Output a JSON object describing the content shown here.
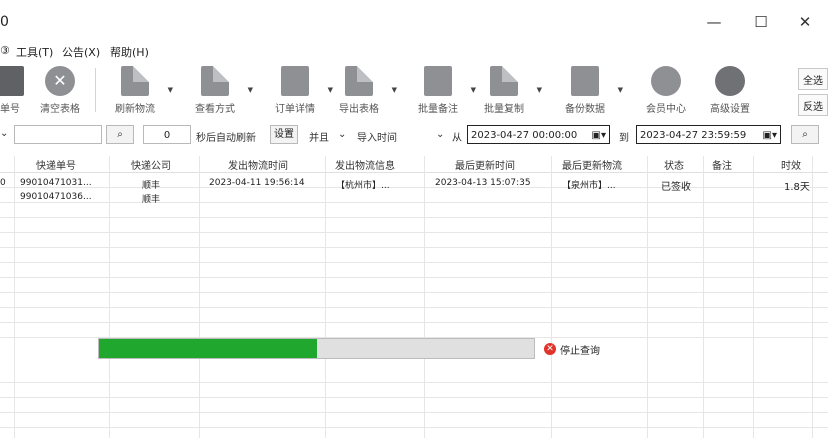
{
  "window": {
    "title": "0",
    "minimize": "—",
    "maximize": "☐",
    "close": "✕"
  },
  "menu": {
    "items": [
      "③",
      "工具(T)",
      "公告(X)",
      "帮助(H)"
    ]
  },
  "toolbar": {
    "items": [
      {
        "label": "单号",
        "icon": "scan-icon"
      },
      {
        "label": "清空表格",
        "icon": "clear-icon"
      },
      {
        "label": "刷新物流",
        "icon": "refresh-icon"
      },
      {
        "label": "查看方式",
        "icon": "view-icon"
      },
      {
        "label": "订单详情",
        "icon": "order-icon"
      },
      {
        "label": "导出表格",
        "icon": "export-icon"
      },
      {
        "label": "批量备注",
        "icon": "note-icon"
      },
      {
        "label": "批量复制",
        "icon": "copy-icon"
      },
      {
        "label": "备份数据",
        "icon": "backup-icon"
      },
      {
        "label": "会员中心",
        "icon": "member-icon"
      },
      {
        "label": "高级设置",
        "icon": "settings-icon"
      }
    ],
    "select_all": "全选",
    "invert": "反选"
  },
  "search": {
    "keyword_value": "",
    "interval_value": "0",
    "auto_refresh_label": "秒后自动刷新",
    "set_label": "设置",
    "range_select": "并且",
    "time_type": "导入时间",
    "from_label": "从",
    "from_datetime": "2023-04-27 00:00:00",
    "to_label": "到",
    "to_datetime": "2023-04-27 23:59:59"
  },
  "table": {
    "columns": [
      "快递单号",
      "快递公司",
      "发出物流时间",
      "发出物流信息",
      "最后更新时间",
      "最后更新物流",
      "状态",
      "备注",
      "时效"
    ],
    "rows": [
      {
        "index": "0",
        "tracking": "99010471031...",
        "company": "顺丰",
        "ship_time": "2023-04-11 19:56:14",
        "ship_info": "【杭州市】...",
        "update_time": "2023-04-13 15:07:35",
        "update_info": "【泉州市】...",
        "status": "已签收",
        "note": "",
        "aging": "1.8天"
      },
      {
        "index": "",
        "tracking": "99010471036...",
        "company": "顺丰",
        "ship_time": "",
        "ship_info": "",
        "update_time": "",
        "update_info": "",
        "status": "",
        "note": "",
        "aging": ""
      }
    ]
  },
  "progress": {
    "value": 0.5
  },
  "stop_button": {
    "label": "停止查询"
  },
  "colors": {
    "progress_fill": "#1fa72e",
    "stop_icon": "#e0332b"
  }
}
